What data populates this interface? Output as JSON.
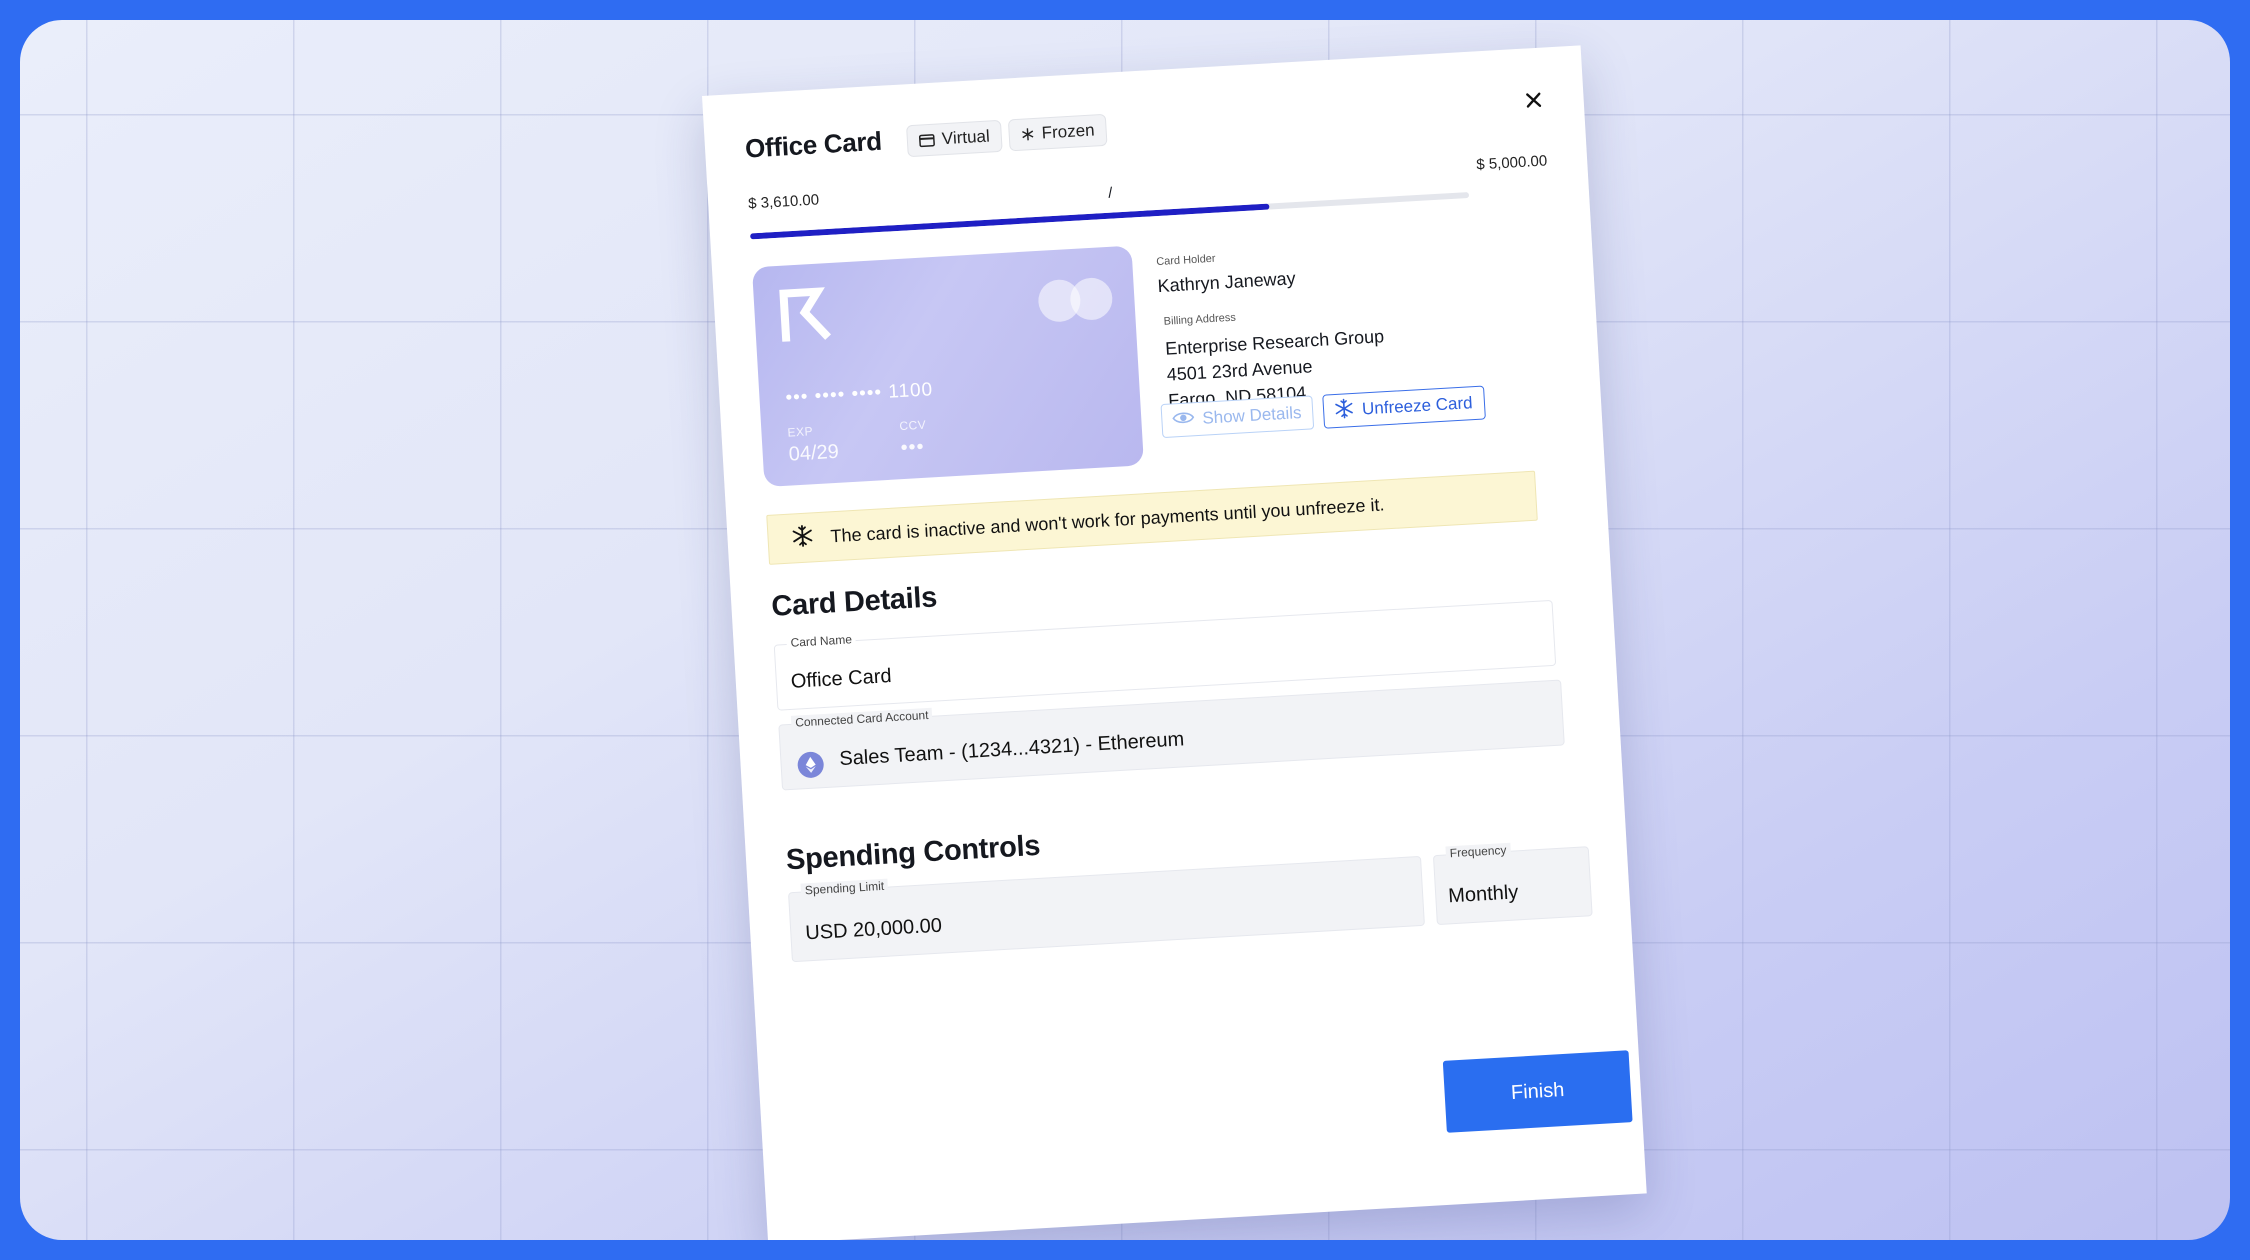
{
  "modal": {
    "title": "Office Card",
    "badges": {
      "virtual": "Virtual",
      "frozen": "Frozen"
    },
    "close_icon": "close-icon"
  },
  "spend": {
    "spent": "$ 3,610.00",
    "separator": "/",
    "limit": "$ 5,000.00",
    "progress_fraction": 0.722
  },
  "card": {
    "number_masked": "••• •••• •••• 1100",
    "exp_label": "EXP",
    "exp_value": "04/29",
    "ccv_label": "CCV",
    "ccv_value": "•••",
    "colors": {
      "gradient_start": "#b6b7f0",
      "gradient_end": "#b9b8ef"
    }
  },
  "holder": {
    "label": "Card Holder",
    "name": "Kathryn Janeway",
    "address_label": "Billing Address",
    "address_line1": "Enterprise Research Group",
    "address_line2": "4501 23rd Avenue",
    "address_line3": "Fargo, ND 58104"
  },
  "actions": {
    "show_details": "Show Details",
    "unfreeze": "Unfreeze Card"
  },
  "banner": {
    "text": "The card is inactive and won't work for payments until you unfreeze it.",
    "icon": "snowflake-icon"
  },
  "details": {
    "section_title": "Card Details",
    "card_name_label": "Card Name",
    "card_name_value": "Office Card",
    "account_label": "Connected Card Account",
    "account_value": "Sales Team - (1234...4321) - Ethereum",
    "account_icon": "ethereum-icon"
  },
  "spending": {
    "section_title": "Spending Controls",
    "limit_label": "Spending Limit",
    "limit_value": "USD 20,000.00",
    "frequency_label": "Frequency",
    "frequency_value": "Monthly"
  },
  "footer": {
    "finish": "Finish"
  },
  "colors": {
    "accent": "#2a6ef0",
    "progress": "#1f1fc4",
    "banner_bg": "#fcf6d4",
    "background": "#2f6cf2"
  }
}
